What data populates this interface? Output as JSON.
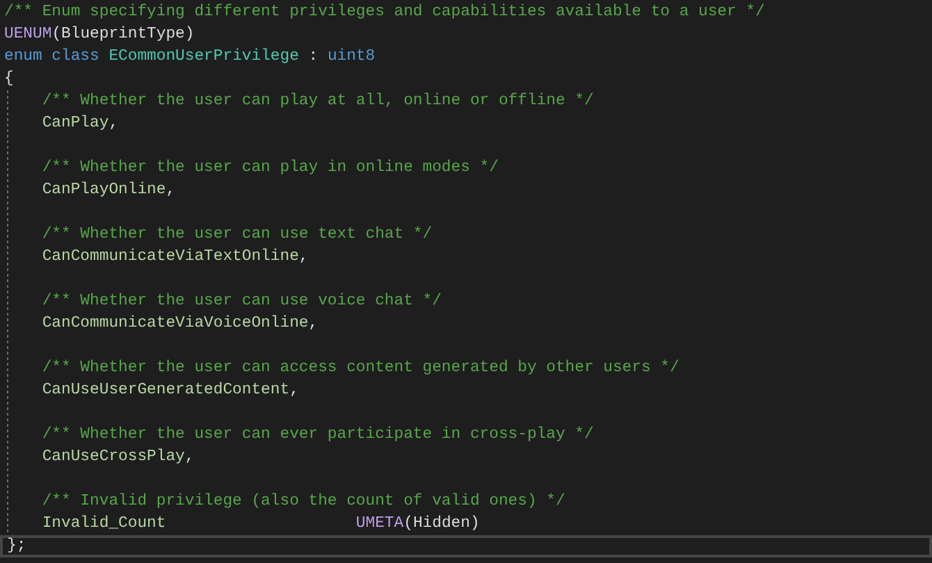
{
  "editor": {
    "header_lines": [
      [
        {
          "kind": "comment",
          "text": "/** Enum specifying different privileges and capabilities available to a user */"
        }
      ],
      [
        {
          "kind": "macro",
          "text": "UENUM"
        },
        {
          "kind": "plain",
          "text": "(BlueprintType)"
        }
      ],
      [
        {
          "kind": "keyword",
          "text": "enum class "
        },
        {
          "kind": "type",
          "text": "ECommonUserPrivilege"
        },
        {
          "kind": "plain",
          "text": " : "
        },
        {
          "kind": "keyword",
          "text": "uint8"
        }
      ],
      [
        {
          "kind": "plain",
          "text": "{"
        }
      ]
    ],
    "body_entries": [
      [
        [
          {
            "kind": "comment",
            "text": "    /** Whether the user can play at all, online or offline */"
          }
        ],
        [
          {
            "kind": "member",
            "text": "    CanPlay"
          },
          {
            "kind": "plain",
            "text": ","
          }
        ]
      ],
      [
        [
          {
            "kind": "comment",
            "text": "    /** Whether the user can play in online modes */"
          }
        ],
        [
          {
            "kind": "member",
            "text": "    CanPlayOnline"
          },
          {
            "kind": "plain",
            "text": ","
          }
        ]
      ],
      [
        [
          {
            "kind": "comment",
            "text": "    /** Whether the user can use text chat */"
          }
        ],
        [
          {
            "kind": "member",
            "text": "    CanCommunicateViaTextOnline"
          },
          {
            "kind": "plain",
            "text": ","
          }
        ]
      ],
      [
        [
          {
            "kind": "comment",
            "text": "    /** Whether the user can use voice chat */"
          }
        ],
        [
          {
            "kind": "member",
            "text": "    CanCommunicateViaVoiceOnline"
          },
          {
            "kind": "plain",
            "text": ","
          }
        ]
      ],
      [
        [
          {
            "kind": "comment",
            "text": "    /** Whether the user can access content generated by other users */"
          }
        ],
        [
          {
            "kind": "member",
            "text": "    CanUseUserGeneratedContent"
          },
          {
            "kind": "plain",
            "text": ","
          }
        ]
      ],
      [
        [
          {
            "kind": "comment",
            "text": "    /** Whether the user can ever participate in cross-play */"
          }
        ],
        [
          {
            "kind": "member",
            "text": "    CanUseCrossPlay"
          },
          {
            "kind": "plain",
            "text": ","
          }
        ]
      ],
      [
        [
          {
            "kind": "comment",
            "text": "    /** Invalid privilege (also the count of valid ones) */"
          }
        ],
        [
          {
            "kind": "member",
            "text": "    Invalid_Count                    "
          },
          {
            "kind": "macro",
            "text": "UMETA"
          },
          {
            "kind": "plain",
            "text": "(Hidden)"
          }
        ]
      ]
    ],
    "footer_lines": [
      {
        "current": true,
        "tokens": [
          {
            "kind": "plain",
            "text": "};"
          }
        ]
      }
    ]
  }
}
